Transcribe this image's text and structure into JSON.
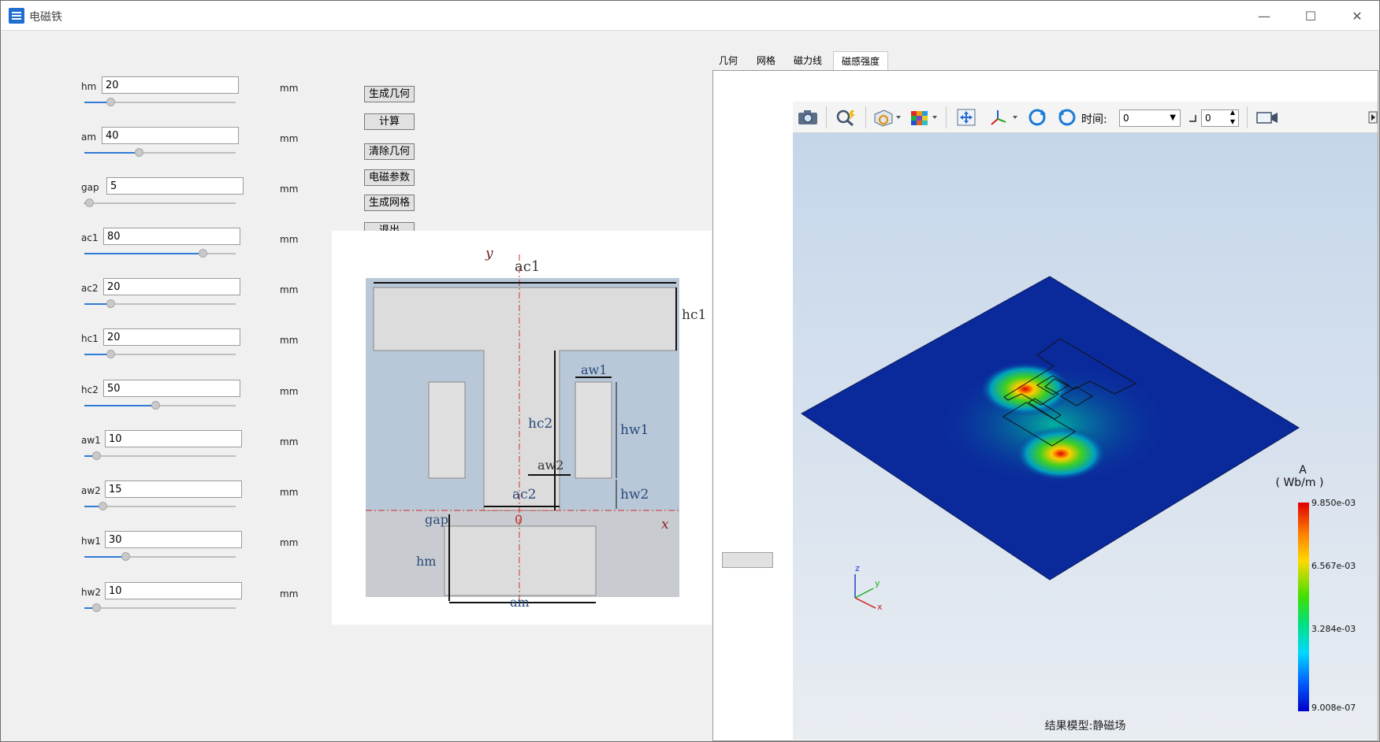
{
  "window": {
    "title": "电磁铁",
    "controls": {
      "minimize": "—",
      "maximize": "☐",
      "close": "✕"
    }
  },
  "params": [
    {
      "name": "hm",
      "value": "20",
      "unit": "mm",
      "slider": 0.17
    },
    {
      "name": "am",
      "value": "40",
      "unit": "mm",
      "slider": 0.36
    },
    {
      "name": "gap",
      "value": "5",
      "unit": "mm",
      "slider": 0.03
    },
    {
      "name": "ac1",
      "value": "80",
      "unit": "mm",
      "slider": 0.78
    },
    {
      "name": "ac2",
      "value": "20",
      "unit": "mm",
      "slider": 0.17
    },
    {
      "name": "hc1",
      "value": "20",
      "unit": "mm",
      "slider": 0.17
    },
    {
      "name": "hc2",
      "value": "50",
      "unit": "mm",
      "slider": 0.47
    },
    {
      "name": "aw1",
      "value": "10",
      "unit": "mm",
      "slider": 0.08
    },
    {
      "name": "aw2",
      "value": "15",
      "unit": "mm",
      "slider": 0.12
    },
    {
      "name": "hw1",
      "value": "30",
      "unit": "mm",
      "slider": 0.27
    },
    {
      "name": "hw2",
      "value": "10",
      "unit": "mm",
      "slider": 0.08
    }
  ],
  "buttons": {
    "gen_geometry": "生成几何",
    "compute": "计算",
    "clear_geometry": "清除几何",
    "em_params": "电磁参数",
    "gen_mesh": "生成网格",
    "exit": "退出"
  },
  "schematic_labels": {
    "y": "y",
    "ac1": "ac1",
    "hc1": "hc1",
    "aw1": "aw1",
    "hc2": "hc2",
    "hw1": "hw1",
    "aw2": "aw2",
    "ac2": "ac2",
    "hw2": "hw2",
    "gap": "gap",
    "origin": "0",
    "x": "x",
    "hm": "hm",
    "am": "am"
  },
  "tabs": [
    {
      "label": "几何"
    },
    {
      "label": "网格"
    },
    {
      "label": "磁力线"
    },
    {
      "label": "磁感强度"
    }
  ],
  "toolbar": {
    "time_label": "时间:",
    "time_value": "0",
    "step_value": "0",
    "icons": [
      "camera-icon",
      "magnify-icon",
      "display-mode-icon",
      "color-cube-icon",
      "fit-view-icon",
      "axis-icon",
      "rotate-cw-icon",
      "rotate-ccw-icon",
      "video-icon"
    ]
  },
  "legend": {
    "unit_top": "A",
    "unit": "( Wb/m )",
    "ticks": [
      "9.850e-03",
      "6.567e-03",
      "3.284e-03",
      "9.008e-07"
    ]
  },
  "triad": {
    "z": "z",
    "y": "y",
    "x": "x"
  },
  "result_model": "结果模型:静磁场",
  "colors": {
    "accent": "#2f7bd6",
    "field_low": "#0a2a9c",
    "field_high": "#e00000"
  }
}
